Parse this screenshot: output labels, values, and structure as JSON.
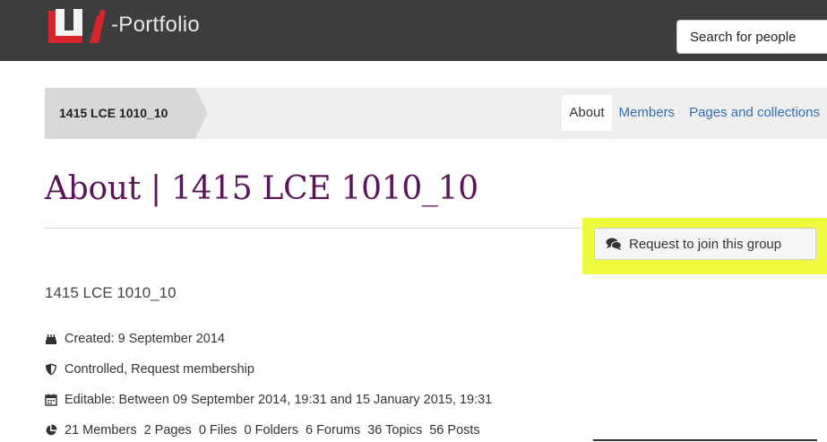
{
  "header": {
    "logo_text": "-Portfolio",
    "search_placeholder": "Search for people"
  },
  "subnav": {
    "group_crumb": "1415 LCE 1010_10",
    "tabs": [
      {
        "label": "About",
        "active": true
      },
      {
        "label": "Members",
        "active": false
      },
      {
        "label": "Pages and collections",
        "active": false
      }
    ]
  },
  "page": {
    "title": "About | 1415 LCE 1010_10",
    "join_button": "Request to join this group",
    "group_name": "1415 LCE 1010_10",
    "created": "Created: 9 September 2014",
    "membership": "Controlled, Request membership",
    "editable": "Editable: Between 09 September 2014, 19:31 and 15 January 2015, 19:31",
    "stats": [
      "21 Members",
      "2 Pages",
      "0 Files",
      "0 Folders",
      "6 Forums",
      "36 Topics",
      "56 Posts"
    ]
  },
  "colors": {
    "header_bg": "#3d3d3d",
    "brand_red": "#d6262c",
    "title_purple": "#5a1657",
    "link_blue": "#2f6db5",
    "highlight_yellow": "#f0fa3c"
  },
  "icons": {
    "created": "birthday-cake-icon",
    "membership": "shield-icon",
    "editable": "calendar-icon",
    "stats": "pie-chart-icon",
    "join": "comments-icon"
  }
}
